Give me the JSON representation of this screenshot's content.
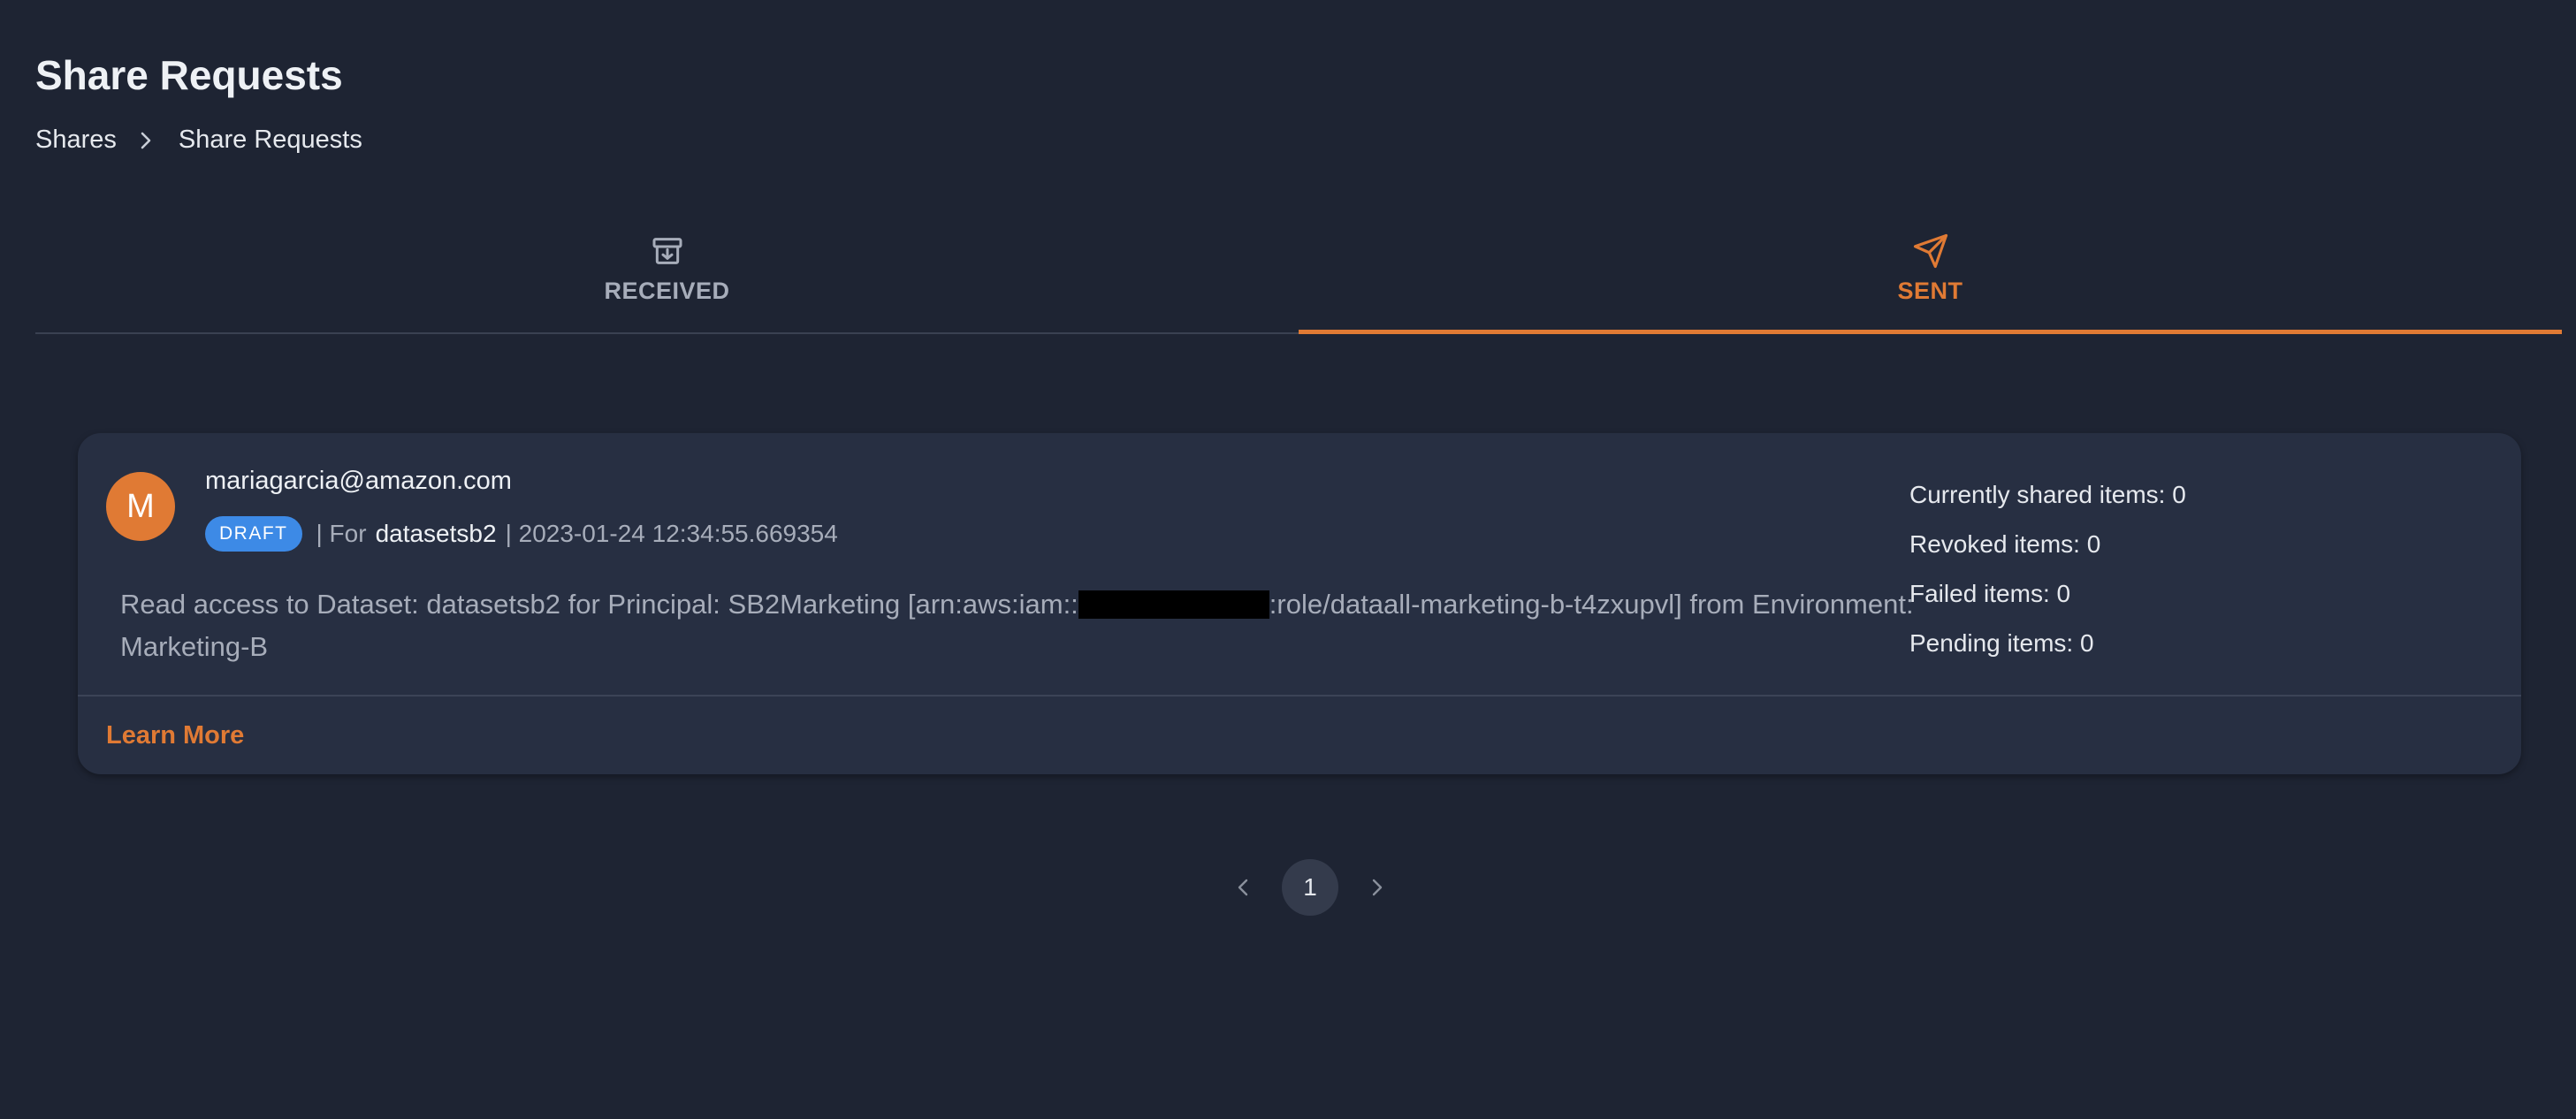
{
  "page": {
    "title": "Share Requests"
  },
  "breadcrumb": {
    "items": [
      "Shares",
      "Share Requests"
    ]
  },
  "tabs": [
    {
      "label": "RECEIVED",
      "icon": "archive-download-icon",
      "active": false
    },
    {
      "label": "SENT",
      "icon": "send-icon",
      "active": true
    }
  ],
  "share_card": {
    "avatar_letter": "M",
    "requester": "mariagarcia@amazon.com",
    "status": "DRAFT",
    "for_prefix": "| For",
    "dataset": "datasetsb2",
    "created": "| 2023-01-24 12:34:55.669354",
    "description_part1": "Read access to Dataset: datasetsb2 for Principal: SB2Marketing [arn:aws:iam::",
    "description_part2": ":role/dataall-marketing-b-t4zxupvl] from Environment: Marketing-B",
    "stats": {
      "shared": "Currently shared items: 0",
      "revoked": "Revoked items: 0",
      "failed": "Failed items: 0",
      "pending": "Pending items: 0"
    },
    "learn_more": "Learn More"
  },
  "pagination": {
    "current_page": "1"
  },
  "colors": {
    "background": "#1e2433",
    "card": "#272f42",
    "accent": "#e07a34",
    "badge": "#3d8ae6",
    "muted_text": "#a7adba"
  }
}
